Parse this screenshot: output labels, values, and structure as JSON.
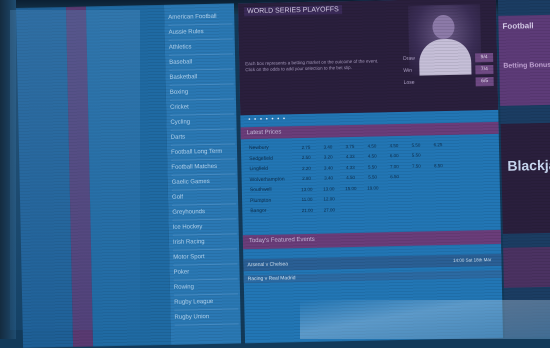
{
  "nav": {
    "items": [
      "American Football",
      "Aussie Rules",
      "Athletics",
      "Baseball",
      "Basketball",
      "Boxing",
      "Cricket",
      "Cycling",
      "Darts",
      "Football Long Term",
      "Football Matches",
      "Gaelic Games",
      "Golf",
      "Greyhounds",
      "Ice Hockey",
      "Irish Racing",
      "Motor Sport",
      "Poker",
      "Rowing",
      "Rugby League",
      "Rugby Union"
    ]
  },
  "hero": {
    "title": "WORLD SERIES PLAYOFFS",
    "text": "Each box represents a betting market on the outcome of the event. Click on the odds to add your selection to the bet slip.",
    "odds": [
      {
        "name": "Draw",
        "val": "9/4"
      },
      {
        "name": "Win",
        "val": "7/4"
      },
      {
        "name": "Lose",
        "val": "6/5"
      }
    ],
    "dots": "• • • • • • •"
  },
  "section": {
    "label": "Latest Prices"
  },
  "table": [
    [
      "Newbury",
      "2.75",
      "3.40",
      "3.75",
      "4.50",
      "4.50",
      "5.50",
      "6.25"
    ],
    [
      "Sedgefield",
      "2.50",
      "3.20",
      "4.33",
      "4.50",
      "6.00",
      "5.50",
      ""
    ],
    [
      "Lingfield",
      "2.20",
      "3.40",
      "4.33",
      "5.50",
      "7.00",
      "7.50",
      "8.50"
    ],
    [
      "Wolverhampton",
      "2.80",
      "3.40",
      "4.50",
      "5.50",
      "6.50",
      "",
      ""
    ],
    [
      "Southwell",
      "13.00",
      "13.00",
      "15.00",
      "19.00",
      "",
      "",
      ""
    ],
    [
      "Plumpton",
      "11.00",
      "12.00",
      "",
      "",
      "",
      "",
      ""
    ],
    [
      "Bangor",
      "21.00",
      "27.00",
      "",
      "",
      "",
      "",
      ""
    ]
  ],
  "footer": {
    "label": "Today's Featured Events",
    "strip_text": "Arsenal v Chelsea",
    "strip_right": "14:00 Sat 18th Mar",
    "row2": "Racing v Real Madrid"
  },
  "ads": {
    "top_title": "Football",
    "top_sub": "Betting Bonus",
    "mid_word": "Blackjack"
  },
  "colors": {
    "screen_tint": "#2276b5",
    "accent_purple": "#6a3d7a"
  }
}
